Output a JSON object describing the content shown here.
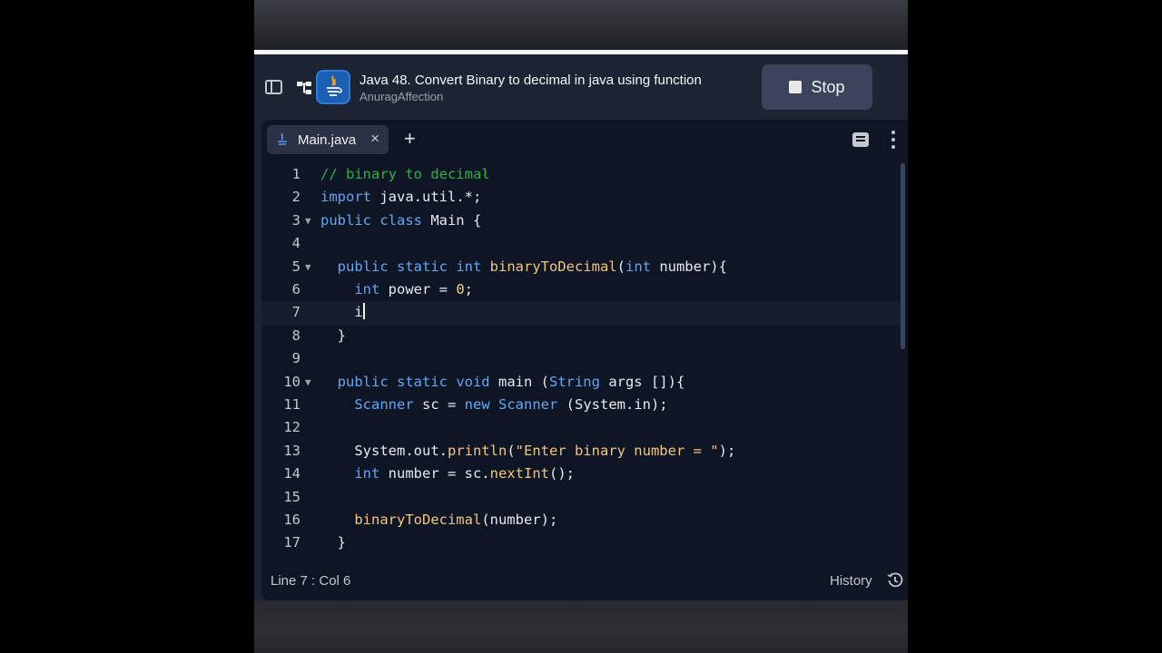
{
  "header": {
    "title": "Java 48. Convert Binary to decimal in java using function",
    "author": "AnuragAffection",
    "stop_label": "Stop"
  },
  "tabs": [
    {
      "label": "Main.java"
    }
  ],
  "editor": {
    "lines": [
      {
        "n": "1",
        "html": "<span class=\"cm\">// binary to decimal</span>"
      },
      {
        "n": "2",
        "html": "<span class=\"kw\">import</span> java.util.*;"
      },
      {
        "n": "3",
        "html": "<span class=\"kw\">public class</span> Main {",
        "fold": true
      },
      {
        "n": "4",
        "html": ""
      },
      {
        "n": "5",
        "html": "  <span class=\"kw\">public static int</span> <span class=\"fn\">binaryToDecimal</span>(<span class=\"kw\">int</span> number){",
        "fold": true
      },
      {
        "n": "6",
        "html": "    <span class=\"kw\">int</span> power = <span class=\"num\">0</span>;"
      },
      {
        "n": "7",
        "html": "    i<span class=\"cursor\"></span>",
        "active": true
      },
      {
        "n": "8",
        "html": "  }"
      },
      {
        "n": "9",
        "html": ""
      },
      {
        "n": "10",
        "html": "  <span class=\"kw\">public static void</span> main (<span class=\"ty\">String</span> args []){",
        "fold": true
      },
      {
        "n": "11",
        "html": "    <span class=\"ty\">Scanner</span> sc = <span class=\"kw\">new</span> <span class=\"ty\">Scanner</span> (System.in);"
      },
      {
        "n": "12",
        "html": ""
      },
      {
        "n": "13",
        "html": "    System.out.<span class=\"fn\">println</span>(<span class=\"str\">\"Enter binary number = \"</span>);"
      },
      {
        "n": "14",
        "html": "    <span class=\"kw\">int</span> number = sc.<span class=\"fn\">nextInt</span>();"
      },
      {
        "n": "15",
        "html": ""
      },
      {
        "n": "16",
        "html": "    <span class=\"fn\">binaryToDecimal</span>(number);"
      },
      {
        "n": "17",
        "html": "  }"
      }
    ]
  },
  "status": {
    "position": "Line 7 : Col 6",
    "history_label": "History"
  },
  "colors": {
    "background": "#1c2333",
    "editor_bg": "#0e1525",
    "keyword": "#62a7f4",
    "comment": "#2ab340",
    "number": "#f2d76b",
    "function": "#f4c57a"
  },
  "icons": [
    "sidebar-toggle-icon",
    "branch-icon",
    "java-icon",
    "close-icon",
    "plus-icon",
    "file-icon",
    "more-icon",
    "history-icon"
  ]
}
